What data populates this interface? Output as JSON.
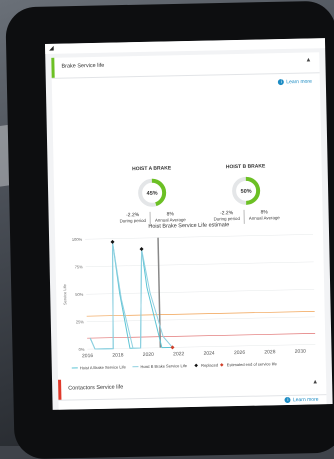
{
  "status": {
    "mark": "◢"
  },
  "brake_panel": {
    "title": "Brake Service life",
    "accent_color": "#6cc024",
    "learn_more": "Learn more",
    "gauges": [
      {
        "title": "HOIST A BRAKE",
        "percent": 45,
        "percent_label": "45%",
        "period_value": "-2.2%",
        "period_label": "During period",
        "annual_value": "8%",
        "annual_label": "Annual Average"
      },
      {
        "title": "HOIST B BRAKE",
        "percent": 50,
        "percent_label": "50%",
        "period_value": "-2.2%",
        "period_label": "During period",
        "annual_value": "8%",
        "annual_label": "Annual Average"
      }
    ]
  },
  "chart_data": {
    "type": "line",
    "title": "Hoist Brake Service Life estimate",
    "ylabel": "Service Life",
    "xlim": [
      2016,
      2031
    ],
    "ylim": [
      0,
      100
    ],
    "x_ticks": [
      2016,
      2018,
      2020,
      2022,
      2024,
      2026,
      2028,
      2030
    ],
    "y_ticks": [
      0,
      25,
      50,
      75,
      100
    ],
    "y_tick_labels": [
      "0%",
      "25%",
      "50%",
      "75%",
      "100%"
    ],
    "thresholds": [
      {
        "value": 30,
        "color": "#f0a050"
      },
      {
        "value": 10,
        "color": "#e07070"
      }
    ],
    "today_line": {
      "x": 2020.8,
      "color": "#888888"
    },
    "series": [
      {
        "name": "Hoist A Brake Service Life",
        "color": "#5cc4d4",
        "points": [
          [
            2016.2,
            10
          ],
          [
            2016.5,
            0
          ],
          [
            2017.7,
            0
          ],
          [
            2017.8,
            97
          ],
          [
            2018.2,
            50
          ],
          [
            2018.8,
            0
          ],
          [
            2019.5,
            0
          ],
          [
            2019.7,
            90
          ],
          [
            2020.0,
            55
          ],
          [
            2020.9,
            0
          ],
          [
            2021.7,
            0
          ]
        ]
      },
      {
        "name": "Hoist B Brake Service Life",
        "color": "#8fd0e0",
        "points": [
          [
            2016.2,
            10
          ],
          [
            2016.5,
            0
          ],
          [
            2017.7,
            0
          ],
          [
            2017.8,
            97
          ],
          [
            2018.3,
            45
          ],
          [
            2019.0,
            0
          ],
          [
            2019.5,
            0
          ],
          [
            2019.7,
            90
          ],
          [
            2020.2,
            50
          ],
          [
            2021.0,
            10
          ],
          [
            2021.6,
            0
          ]
        ]
      }
    ],
    "replaced": [
      [
        2017.8,
        97
      ],
      [
        2019.7,
        90
      ]
    ],
    "estimated_end": [
      [
        2021.6,
        0
      ]
    ],
    "legend": [
      {
        "label": "Hoist A Brake Service Life",
        "kind": "line",
        "color": "#5cc4d4"
      },
      {
        "label": "Hoist B Brake Service Life",
        "kind": "line",
        "color": "#8fd0e0"
      },
      {
        "label": "Replaced",
        "kind": "diamond",
        "color": "#111111"
      },
      {
        "label": "Estimated end of service life",
        "kind": "diamond",
        "color": "#d0402a"
      }
    ],
    "legend_position": "bottom"
  },
  "contactors_panel": {
    "title": "Contactors Service life",
    "accent_color": "#e0392b",
    "learn_more": "Learn more"
  }
}
